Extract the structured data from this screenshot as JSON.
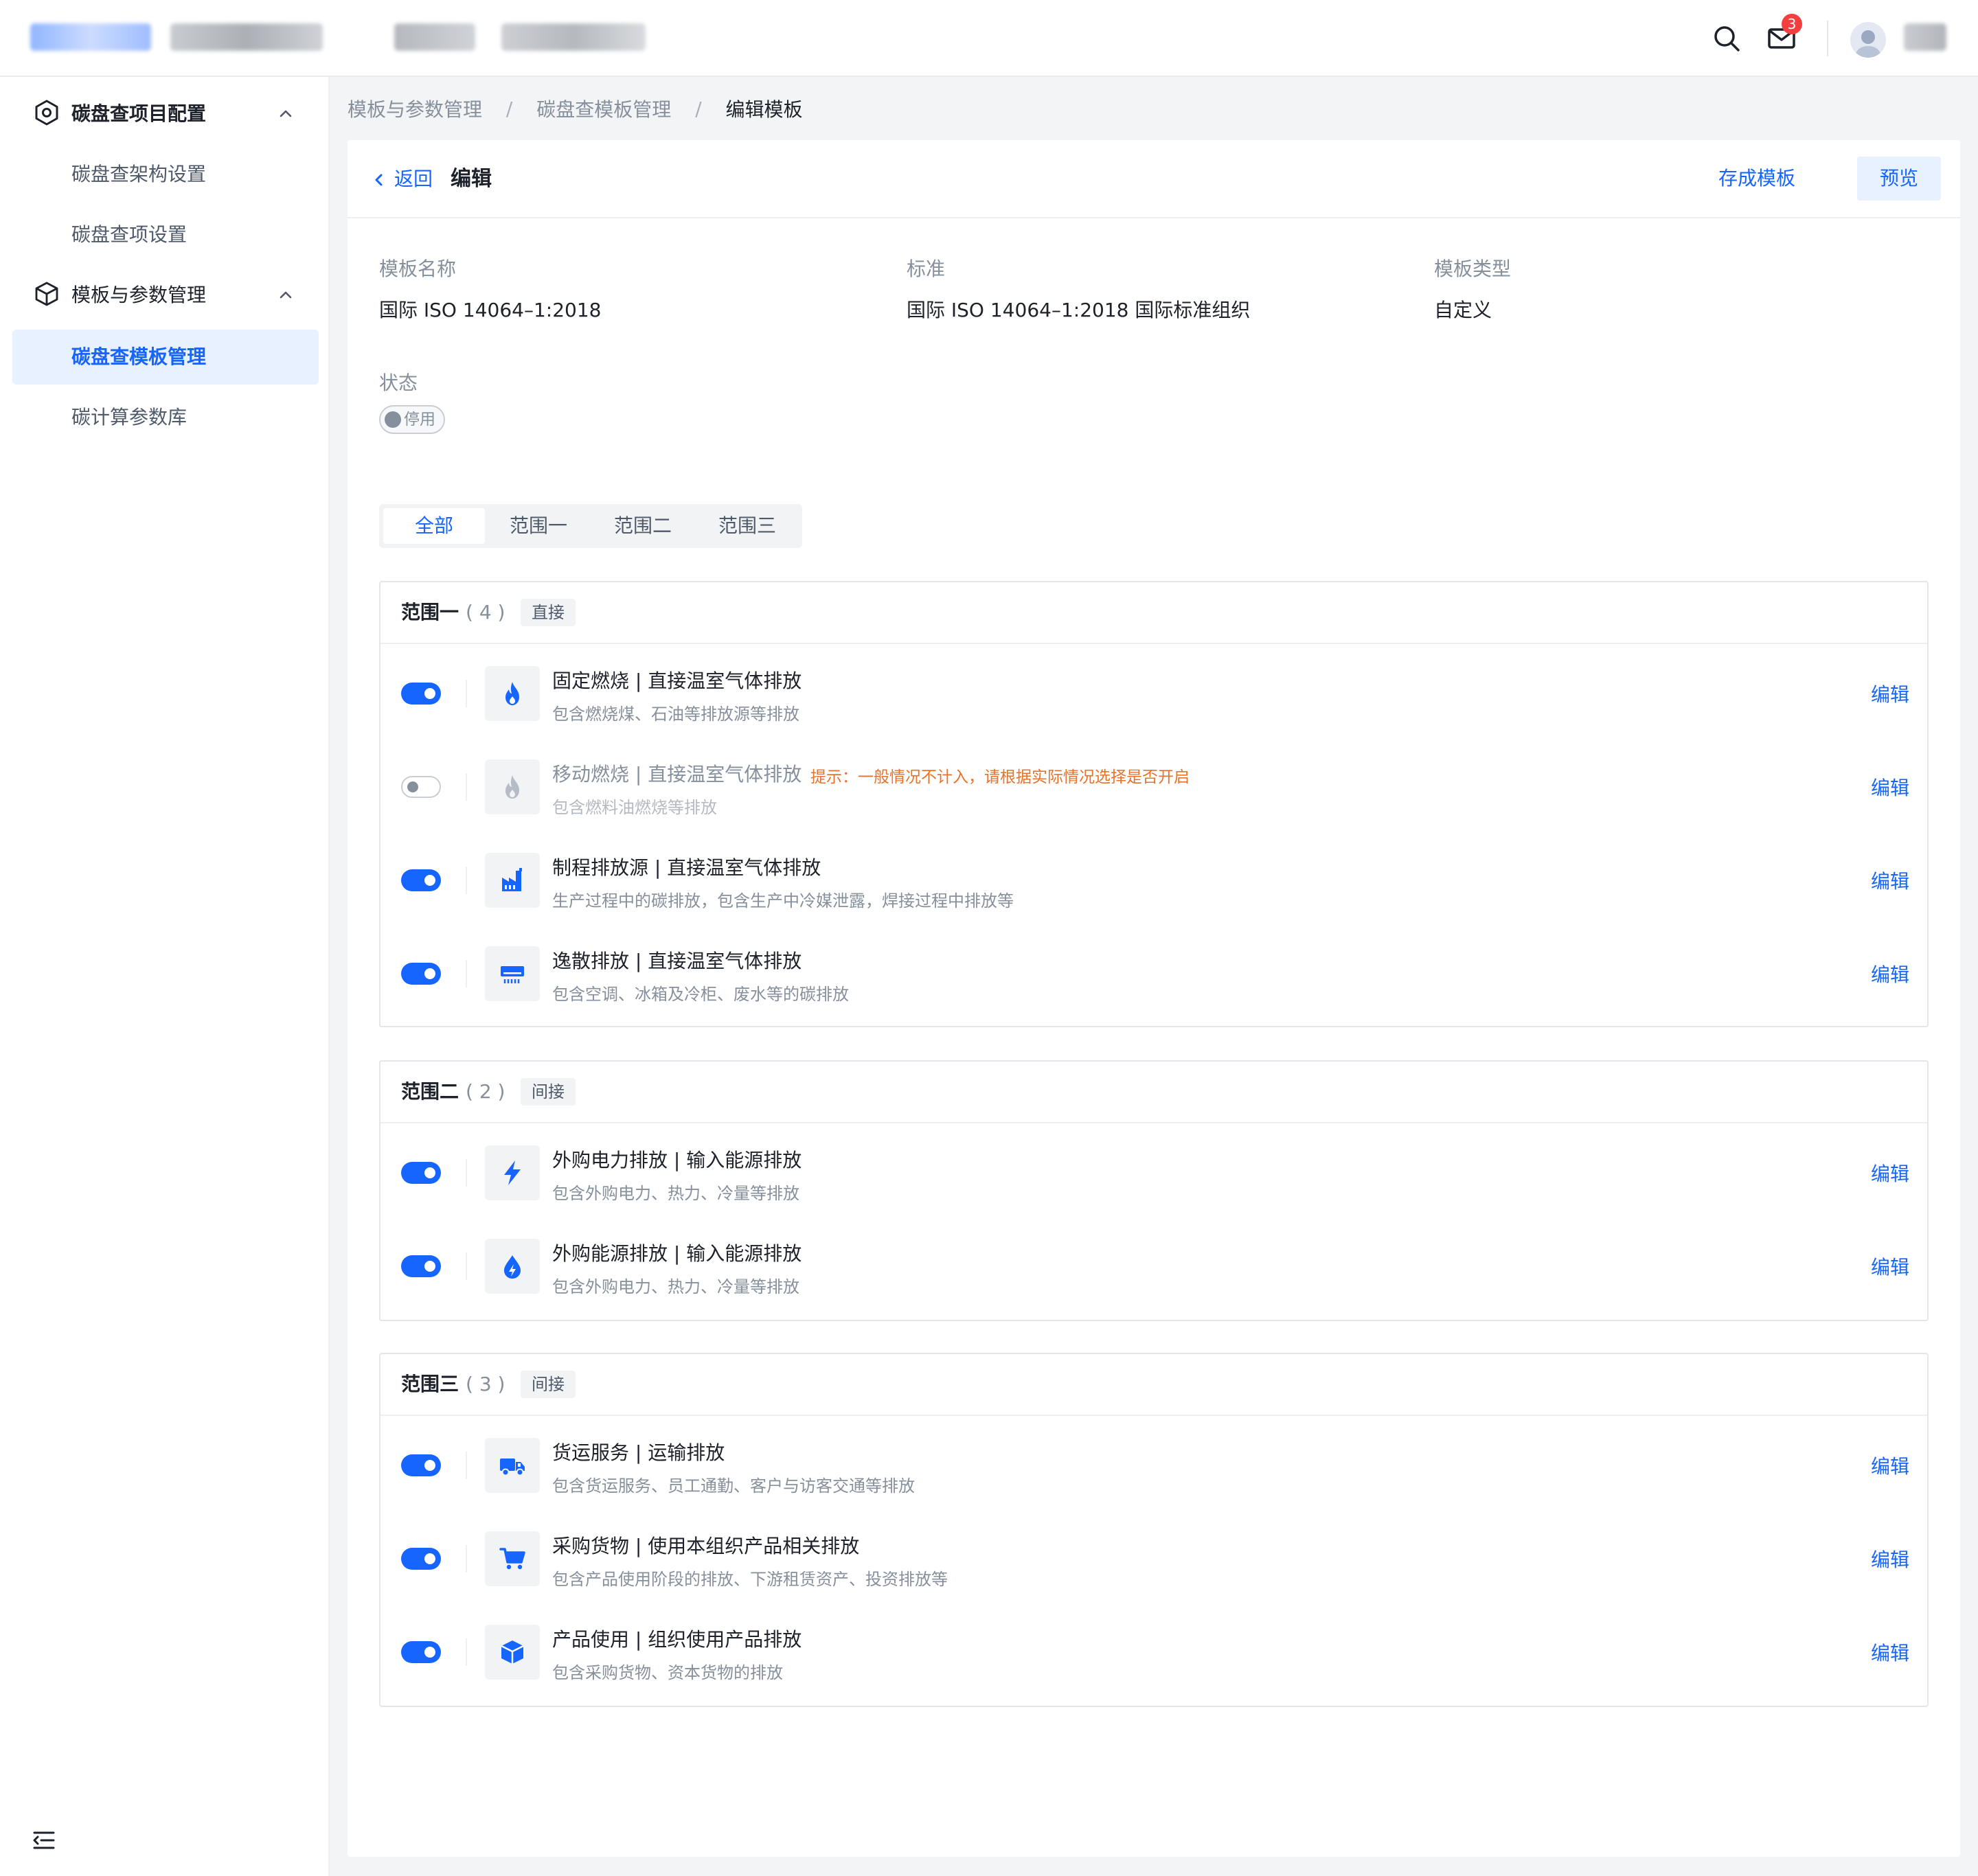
{
  "header": {
    "mail_badge": "3",
    "icons": [
      "search-icon",
      "mail-icon",
      "avatar"
    ]
  },
  "sidebar": {
    "groups": [
      {
        "label": "碳盘查项目配置",
        "icon": "settings-hexagon-icon",
        "items": [
          {
            "label": "碳盘查架构设置"
          },
          {
            "label": "碳盘查项设置"
          }
        ]
      },
      {
        "label": "模板与参数管理",
        "icon": "cube-icon",
        "items": [
          {
            "label": "碳盘查模板管理",
            "active": true
          },
          {
            "label": "碳计算参数库"
          }
        ]
      }
    ]
  },
  "breadcrumb": [
    "模板与参数管理",
    "碳盘查模板管理",
    "编辑模板"
  ],
  "page": {
    "back_label": "返回",
    "title": "编辑",
    "save_template_label": "存成模板",
    "preview_label": "预览"
  },
  "info": {
    "name_label": "模板名称",
    "name_value": "国际 ISO 14064–1:2018",
    "standard_label": "标准",
    "standard_value": "国际 ISO 14064–1:2018 国际标准组织",
    "type_label": "模板类型",
    "type_value": "自定义",
    "status_label": "状态",
    "status_value": "停用"
  },
  "tabs": [
    {
      "label": "全部",
      "active": true
    },
    {
      "label": "范围一"
    },
    {
      "label": "范围二"
    },
    {
      "label": "范围三"
    }
  ],
  "edit_label": "编辑",
  "scopes": [
    {
      "title": "范围一",
      "count": "( 4 )",
      "tag": "直接",
      "items": [
        {
          "title": "固定燃烧 | 直接温室气体排放",
          "desc": "包含燃烧煤、石油等排放源等排放",
          "enabled": true,
          "icon": "flame-icon"
        },
        {
          "title": "移动燃烧 | 直接温室气体排放",
          "desc": "包含燃料油燃烧等排放",
          "enabled": false,
          "icon": "flame-icon",
          "hint": "提示：一般情况不计入，请根据实际情况选择是否开启"
        },
        {
          "title": "制程排放源 | 直接温室气体排放",
          "desc": "生产过程中的碳排放，包含生产中冷媒泄露，焊接过程中排放等",
          "enabled": true,
          "icon": "factory-icon"
        },
        {
          "title": "逸散排放 | 直接温室气体排放",
          "desc": "包含空调、冰箱及冷柜、废水等的碳排放",
          "enabled": true,
          "icon": "air-conditioner-icon"
        }
      ]
    },
    {
      "title": "范围二",
      "count": "( 2 )",
      "tag": "间接",
      "items": [
        {
          "title": "外购电力排放 | 输入能源排放",
          "desc": "包含外购电力、热力、冷量等排放",
          "enabled": true,
          "icon": "lightning-icon"
        },
        {
          "title": "外购能源排放 | 输入能源排放",
          "desc": "包含外购电力、热力、冷量等排放",
          "enabled": true,
          "icon": "energy-drop-icon"
        }
      ]
    },
    {
      "title": "范围三",
      "count": "( 3 )",
      "tag": "间接",
      "items": [
        {
          "title": "货运服务 | 运输排放",
          "desc": "包含货运服务、员工通勤、客户与访客交通等排放",
          "enabled": true,
          "icon": "truck-icon"
        },
        {
          "title": "采购货物 | 使用本组织产品相关排放",
          "desc": "包含产品使用阶段的排放、下游租赁资产、投资排放等",
          "enabled": true,
          "icon": "cart-icon"
        },
        {
          "title": "产品使用 | 组织使用产品排放",
          "desc": "包含采购货物、资本货物的排放",
          "enabled": true,
          "icon": "box-icon"
        }
      ]
    }
  ],
  "colors": {
    "primary": "#1765ff",
    "active_bg": "#e8f1ff",
    "hint": "#e8722a",
    "badge": "#f53f3f"
  }
}
